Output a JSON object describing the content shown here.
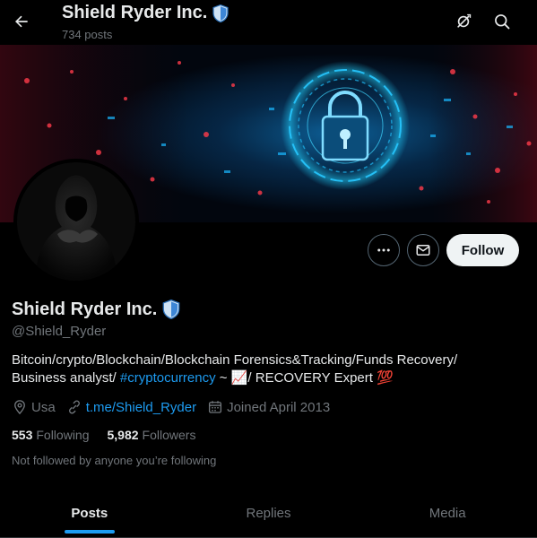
{
  "header": {
    "title": "Shield Ryder Inc.",
    "post_count": "734 posts"
  },
  "profile": {
    "display_name": "Shield Ryder Inc.",
    "handle": "@Shield_Ryder",
    "bio_line1": "Bitcoin/crypto/Blockchain/Blockchain Forensics&Tracking/Funds Recovery/",
    "bio_line2_pre": "Business analyst/ ",
    "bio_hashtag": "#cryptocurrency",
    "bio_line2_mid": " ~ ",
    "bio_emoji_chart": "📈",
    "bio_line2_post": "/ RECOVERY Expert ",
    "bio_emoji_100": "💯",
    "location": "Usa",
    "website": "t.me/Shield_Ryder",
    "joined": "Joined April 2013",
    "following_count": "553",
    "following_label": "Following",
    "followers_count": "5,982",
    "followers_label": "Followers",
    "not_followed": "Not followed by anyone you’re following"
  },
  "actions": {
    "follow_label": "Follow",
    "more_icon": "more-icon",
    "message_icon": "envelope-icon"
  },
  "tabs": [
    {
      "label": "Posts",
      "active": true
    },
    {
      "label": "Replies",
      "active": false
    },
    {
      "label": "Media",
      "active": false
    }
  ],
  "colors": {
    "accent": "#1d9bf0",
    "background": "#000000",
    "muted": "#71767b",
    "text": "#e7e9ea",
    "verified_shield": "#4a90d9"
  }
}
